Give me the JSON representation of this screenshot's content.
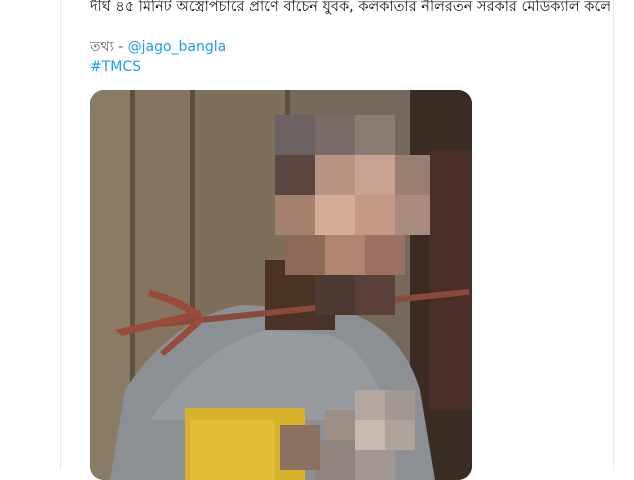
{
  "tweet": {
    "text": "দীর্ঘ ৪৫ মিনিট অস্ত্রোপচারে প্রাণে বাঁচেন যুবক, কলকাতার নীলরতন সরকার মেডিক্যাল কলেজে",
    "source_label": "তথ্য - ",
    "source_handle": "@jago_bangla",
    "hashtag": "#TMCS"
  },
  "media": {
    "alt_icon": "photo-image",
    "colors": {
      "wood": "#7c6d58",
      "shirt": "#8c8f93",
      "skin": "#4a3324",
      "trident": "#9a4a39",
      "yellow": "#d8b22b"
    }
  }
}
